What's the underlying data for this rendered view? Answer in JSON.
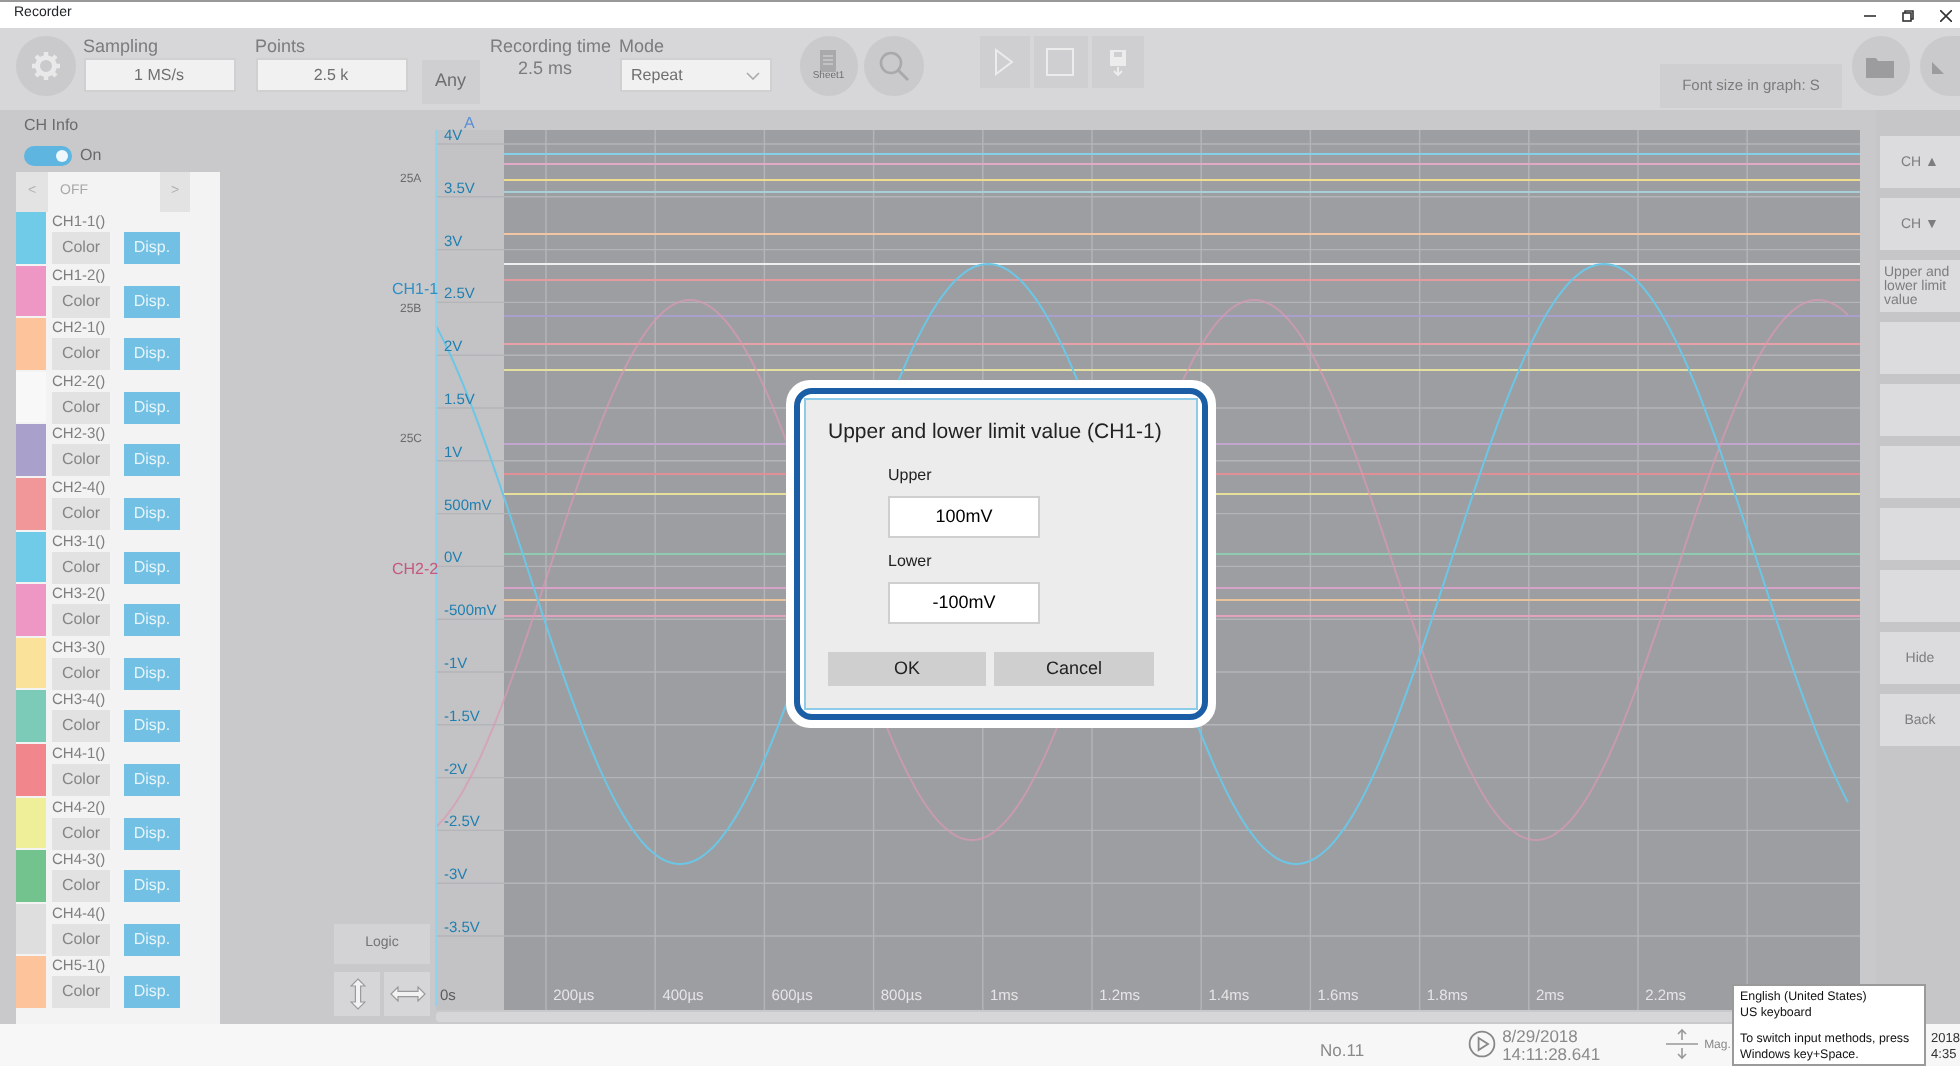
{
  "window": {
    "title": "Recorder"
  },
  "toolbar": {
    "sampling": {
      "label": "Sampling",
      "value": "1 MS/s"
    },
    "points": {
      "label": "Points",
      "value": "2.5 k"
    },
    "any_button": "Any",
    "recording_time": {
      "label": "Recording time",
      "value": "2.5 ms"
    },
    "mode": {
      "label": "Mode",
      "value": "Repeat"
    },
    "sheet_button": "Sheet1",
    "font_size_button": "Font size in graph: S"
  },
  "ch_info": {
    "label": "CH Info",
    "toggle": {
      "on": true,
      "label": "On"
    },
    "pager": {
      "prev": "<",
      "value": "OFF",
      "next": ">"
    }
  },
  "channels": [
    {
      "name": "CH1-1()",
      "color": "#6fcbe8",
      "color_button": "Color",
      "display_button": "Disp."
    },
    {
      "name": "CH1-2()",
      "color": "#ee97c4",
      "color_button": "Color",
      "display_button": "Disp."
    },
    {
      "name": "CH2-1()",
      "color": "#fdc39a",
      "color_button": "Color",
      "display_button": "Disp."
    },
    {
      "name": "CH2-2()",
      "color": "#f8f8f8",
      "color_button": "Color",
      "display_button": "Disp."
    },
    {
      "name": "CH2-3()",
      "color": "#a9a0cc",
      "color_button": "Color",
      "display_button": "Disp."
    },
    {
      "name": "CH2-4()",
      "color": "#f29799",
      "color_button": "Color",
      "display_button": "Disp."
    },
    {
      "name": "CH3-1()",
      "color": "#6fcbe8",
      "color_button": "Color",
      "display_button": "Disp."
    },
    {
      "name": "CH3-2()",
      "color": "#ee97c4",
      "color_button": "Color",
      "display_button": "Disp."
    },
    {
      "name": "CH3-3()",
      "color": "#fbe29a",
      "color_button": "Color",
      "display_button": "Disp."
    },
    {
      "name": "CH3-4()",
      "color": "#7ccbb9",
      "color_button": "Color",
      "display_button": "Disp."
    },
    {
      "name": "CH4-1()",
      "color": "#f2868d",
      "color_button": "Color",
      "display_button": "Disp."
    },
    {
      "name": "CH4-2()",
      "color": "#f0ef99",
      "color_button": "Color",
      "display_button": "Disp."
    },
    {
      "name": "CH4-3()",
      "color": "#72c38d",
      "color_button": "Color",
      "display_button": "Disp."
    },
    {
      "name": "CH4-4()",
      "color": "#dedede",
      "color_button": "Color",
      "display_button": "Disp."
    },
    {
      "name": "CH5-1()",
      "color": "#fdc39a",
      "color_button": "Color",
      "display_button": "Disp."
    }
  ],
  "graph": {
    "sheet_label": "A",
    "group_labels": [
      "25A",
      "25B",
      "25C"
    ],
    "markers": [
      {
        "text": "CH1-1",
        "color": "#2f8fc4"
      },
      {
        "text": "CH2-2",
        "color": "#c4587e"
      }
    ],
    "y_labels": [
      "4V",
      "3.5V",
      "3V",
      "2.5V",
      "2V",
      "1.5V",
      "1V",
      "500mV",
      "0V",
      "-500mV",
      "-1V",
      "-1.5V",
      "-2V",
      "-2.5V",
      "-3V",
      "-3.5V"
    ],
    "x_labels": [
      "0s",
      "200µs",
      "400µs",
      "600µs",
      "800µs",
      "1ms",
      "1.2ms",
      "1.4ms",
      "1.6ms",
      "1.8ms",
      "2ms",
      "2.2ms"
    ],
    "logic_button": "Logic"
  },
  "side_buttons": [
    {
      "kind": "text",
      "label": "CH ▲"
    },
    {
      "kind": "text",
      "label": "CH ▼"
    },
    {
      "kind": "text",
      "label": "Upper and lower limit value"
    },
    {
      "kind": "blank"
    },
    {
      "kind": "blank"
    },
    {
      "kind": "blank"
    },
    {
      "kind": "blank"
    },
    {
      "kind": "blank"
    },
    {
      "kind": "text",
      "label": "Hide"
    },
    {
      "kind": "text",
      "label": "Back"
    }
  ],
  "dialog": {
    "title": "Upper and lower limit value (CH1-1)",
    "upper_label": "Upper",
    "upper_value": "100mV",
    "lower_label": "Lower",
    "lower_value": "-100mV",
    "ok_button": "OK",
    "cancel_button": "Cancel"
  },
  "status_bar": {
    "number": "No.11",
    "date": "8/29/2018",
    "time": "14:11:28.641",
    "mag": "Mag.",
    "clock_date": "2018",
    "clock_time": "4:35"
  },
  "ime_tooltip": {
    "lines": [
      "English (United States)",
      "US keyboard"
    ],
    "hint": "To switch input methods, press Windows key+Space."
  }
}
